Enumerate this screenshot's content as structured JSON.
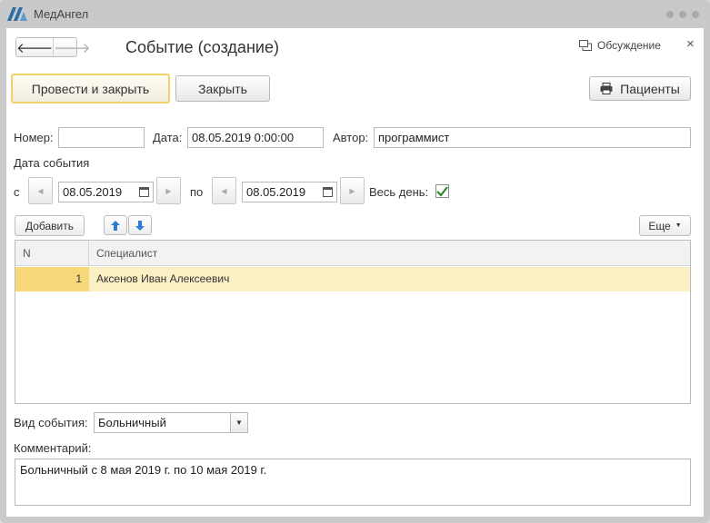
{
  "app": {
    "title": "МедАнгел",
    "brand_color": "#2a6ea6"
  },
  "header": {
    "back_icon": "arrow-left",
    "forward_icon": "arrow-right",
    "form_title": "Событие (создание)",
    "discuss_label": "Обсуждение",
    "close_symbol": "×"
  },
  "toolbar": {
    "post_close_label": "Провести и закрыть",
    "close_label": "Закрыть",
    "patients_label": "Пациенты"
  },
  "fields": {
    "number_label": "Номер:",
    "number_value": "",
    "date_label": "Дата:",
    "date_value": "08.05.2019  0:00:00",
    "author_label": "Автор:",
    "author_value": "программист",
    "event_date_heading": "Дата события",
    "from_label": "с",
    "from_date": "08.05.2019",
    "to_label": "по",
    "to_date": "08.05.2019",
    "all_day_label": "Весь день:",
    "all_day_checked": true
  },
  "table_toolbar": {
    "add_label": "Добавить",
    "up_icon": "arrow-up",
    "down_icon": "arrow-down",
    "more_label": "Еще"
  },
  "table": {
    "columns": [
      "N",
      "Специалист"
    ],
    "rows": [
      {
        "n": "1",
        "specialist": "Аксенов Иван Алексеевич"
      }
    ]
  },
  "event_type": {
    "label": "Вид события:",
    "value": "Больничный"
  },
  "comment": {
    "label": "Комментарий:",
    "value": "Больничный с 8 мая 2019 г. по 10 мая 2019 г."
  }
}
